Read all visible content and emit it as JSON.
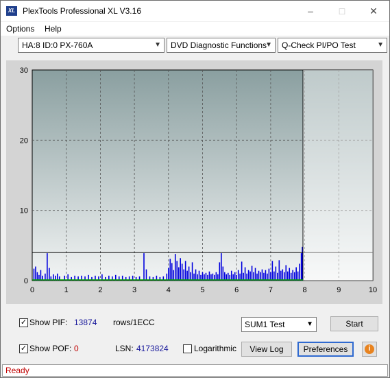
{
  "window": {
    "title": "PlexTools Professional XL V3.16",
    "icon_text": "XL"
  },
  "menu": {
    "options": "Options",
    "help": "Help"
  },
  "toolbar": {
    "drive_select": "HA:8 ID:0  PX-760A",
    "function_select": "DVD Diagnostic Functions",
    "test_select": "Q-Check PI/PO Test"
  },
  "chart_data": {
    "type": "bar",
    "x_ticks": [
      "0",
      "1",
      "2",
      "3",
      "4",
      "5",
      "6",
      "7",
      "8",
      "9",
      "10"
    ],
    "y_ticks": [
      "0",
      "10",
      "20",
      "30"
    ],
    "xlim": [
      0,
      10
    ],
    "ylim": [
      0,
      30
    ],
    "grid": true,
    "threshold_y": 4,
    "end_marker_x": 7.95,
    "series_color": "#0000dd",
    "baseline_color": "#00a000",
    "bg_top_color": "#8a9fa0",
    "bg_bottom_color": "#f2f4f4",
    "bars": [
      [
        0.05,
        1.7
      ],
      [
        0.1,
        2.0
      ],
      [
        0.15,
        1.2
      ],
      [
        0.2,
        0.8
      ],
      [
        0.25,
        1.5
      ],
      [
        0.3,
        0.7
      ],
      [
        0.38,
        1.0
      ],
      [
        0.44,
        3.9
      ],
      [
        0.5,
        1.8
      ],
      [
        0.55,
        0.6
      ],
      [
        0.62,
        0.9
      ],
      [
        0.68,
        0.7
      ],
      [
        0.74,
        1.0
      ],
      [
        0.8,
        0.6
      ],
      [
        0.95,
        0.7
      ],
      [
        1.05,
        0.9
      ],
      [
        1.15,
        0.5
      ],
      [
        1.25,
        0.7
      ],
      [
        1.35,
        0.6
      ],
      [
        1.45,
        0.7
      ],
      [
        1.55,
        0.6
      ],
      [
        1.65,
        0.8
      ],
      [
        1.75,
        0.5
      ],
      [
        1.85,
        0.7
      ],
      [
        1.95,
        0.6
      ],
      [
        2.05,
        0.9
      ],
      [
        2.15,
        0.5
      ],
      [
        2.25,
        0.7
      ],
      [
        2.35,
        0.6
      ],
      [
        2.45,
        0.8
      ],
      [
        2.55,
        0.6
      ],
      [
        2.65,
        0.7
      ],
      [
        2.75,
        0.5
      ],
      [
        2.85,
        0.6
      ],
      [
        2.95,
        0.7
      ],
      [
        3.05,
        0.5
      ],
      [
        3.15,
        0.6
      ],
      [
        3.28,
        3.9
      ],
      [
        3.35,
        1.6
      ],
      [
        3.45,
        0.6
      ],
      [
        3.55,
        0.5
      ],
      [
        3.65,
        0.7
      ],
      [
        3.75,
        0.5
      ],
      [
        3.85,
        0.6
      ],
      [
        3.95,
        1.0
      ],
      [
        4.0,
        1.8
      ],
      [
        4.05,
        3.1
      ],
      [
        4.1,
        2.5
      ],
      [
        4.15,
        1.5
      ],
      [
        4.2,
        3.8
      ],
      [
        4.25,
        2.8
      ],
      [
        4.3,
        1.9
      ],
      [
        4.35,
        3.2
      ],
      [
        4.4,
        2.4
      ],
      [
        4.45,
        1.6
      ],
      [
        4.5,
        2.8
      ],
      [
        4.55,
        1.4
      ],
      [
        4.6,
        2.0
      ],
      [
        4.65,
        1.2
      ],
      [
        4.7,
        2.6
      ],
      [
        4.75,
        1.0
      ],
      [
        4.8,
        1.6
      ],
      [
        4.85,
        0.9
      ],
      [
        4.9,
        1.4
      ],
      [
        4.95,
        0.8
      ],
      [
        5.0,
        1.2
      ],
      [
        5.05,
        0.9
      ],
      [
        5.1,
        1.1
      ],
      [
        5.15,
        0.8
      ],
      [
        5.2,
        1.3
      ],
      [
        5.25,
        0.9
      ],
      [
        5.3,
        1.0
      ],
      [
        5.35,
        0.8
      ],
      [
        5.4,
        1.2
      ],
      [
        5.45,
        0.9
      ],
      [
        5.5,
        2.6
      ],
      [
        5.55,
        3.9
      ],
      [
        5.6,
        2.0
      ],
      [
        5.65,
        1.2
      ],
      [
        5.7,
        0.9
      ],
      [
        5.75,
        1.1
      ],
      [
        5.8,
        0.8
      ],
      [
        5.85,
        1.4
      ],
      [
        5.9,
        0.9
      ],
      [
        5.95,
        1.2
      ],
      [
        6.0,
        0.8
      ],
      [
        6.05,
        1.5
      ],
      [
        6.1,
        1.0
      ],
      [
        6.15,
        2.7
      ],
      [
        6.2,
        1.1
      ],
      [
        6.25,
        1.9
      ],
      [
        6.3,
        1.0
      ],
      [
        6.35,
        1.5
      ],
      [
        6.4,
        1.3
      ],
      [
        6.45,
        2.1
      ],
      [
        6.5,
        1.2
      ],
      [
        6.55,
        1.8
      ],
      [
        6.6,
        1.0
      ],
      [
        6.65,
        1.4
      ],
      [
        6.7,
        1.2
      ],
      [
        6.75,
        1.6
      ],
      [
        6.8,
        1.1
      ],
      [
        6.85,
        1.5
      ],
      [
        6.9,
        1.0
      ],
      [
        6.95,
        1.7
      ],
      [
        7.0,
        1.2
      ],
      [
        7.05,
        2.8
      ],
      [
        7.1,
        1.3
      ],
      [
        7.15,
        2.0
      ],
      [
        7.2,
        1.1
      ],
      [
        7.25,
        2.9
      ],
      [
        7.3,
        1.4
      ],
      [
        7.35,
        1.6
      ],
      [
        7.4,
        1.2
      ],
      [
        7.45,
        2.2
      ],
      [
        7.5,
        1.3
      ],
      [
        7.55,
        1.8
      ],
      [
        7.6,
        1.1
      ],
      [
        7.65,
        1.5
      ],
      [
        7.7,
        1.2
      ],
      [
        7.75,
        1.9
      ],
      [
        7.8,
        1.3
      ],
      [
        7.85,
        2.4
      ],
      [
        7.9,
        3.9
      ],
      [
        7.93,
        4.8
      ]
    ]
  },
  "controls": {
    "show_pif_label": "Show PIF:",
    "pif_value": "13874",
    "pif_unit": "rows/1ECC",
    "show_pof_label": "Show POF:",
    "pof_value": "0",
    "lsn_label": "LSN:",
    "lsn_value": "4173824",
    "logarithmic_label": "Logarithmic",
    "sum_select": "SUM1 Test",
    "start_button": "Start",
    "view_log_button": "View Log",
    "preferences_button": "Preferences"
  },
  "status": {
    "text": "Ready"
  }
}
